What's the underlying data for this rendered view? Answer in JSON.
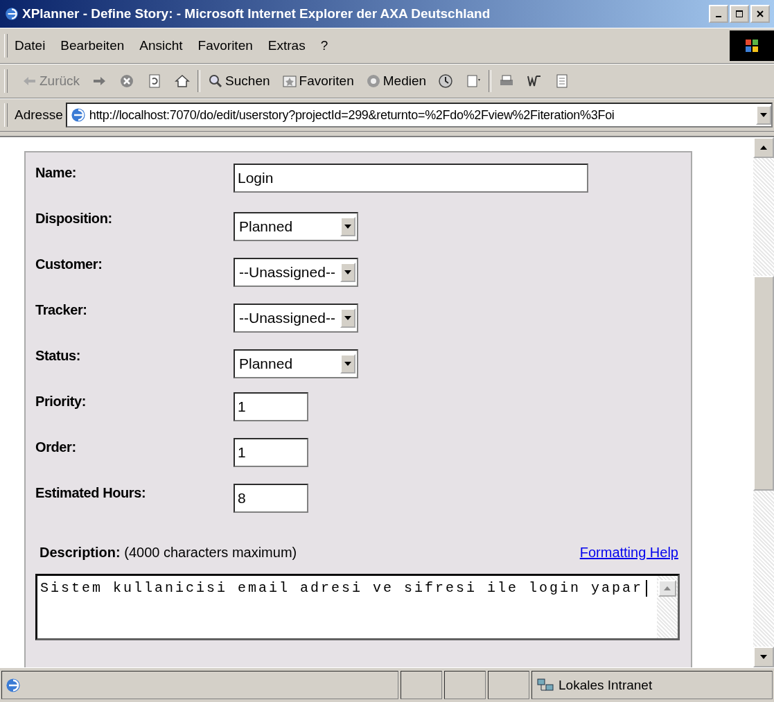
{
  "window": {
    "title": "XPlanner - Define Story: - Microsoft Internet Explorer der AXA Deutschland"
  },
  "menu": [
    "Datei",
    "Bearbeiten",
    "Ansicht",
    "Favoriten",
    "Extras",
    "?"
  ],
  "toolbar": [
    {
      "kind": "back",
      "label": "Zurück",
      "disabled": true
    },
    {
      "kind": "forward",
      "disabled": false
    },
    {
      "kind": "stop"
    },
    {
      "kind": "refresh"
    },
    {
      "kind": "home"
    },
    {
      "kind": "search",
      "label": "Suchen"
    },
    {
      "kind": "favorites",
      "label": "Favoriten"
    },
    {
      "kind": "media",
      "label": "Medien"
    },
    {
      "kind": "history"
    },
    {
      "kind": "mail"
    },
    {
      "kind": "print"
    },
    {
      "kind": "edit"
    },
    {
      "kind": "discuss"
    }
  ],
  "address": {
    "label": "Adresse",
    "value": "http://localhost:7070/do/edit/userstory?projectId=299&returnto=%2Fdo%2Fview%2Fiteration%3Foi"
  },
  "form": {
    "fields": [
      {
        "label": "Name:",
        "kind": "text",
        "value": "Login"
      },
      {
        "label": "Disposition:",
        "kind": "select",
        "value": "Planned"
      },
      {
        "label": "Customer:",
        "kind": "select",
        "value": "--Unassigned--"
      },
      {
        "label": "Tracker:",
        "kind": "select",
        "value": "--Unassigned--"
      },
      {
        "label": "Status:",
        "kind": "select",
        "value": "Planned"
      },
      {
        "label": "Priority:",
        "kind": "number",
        "value": "1"
      },
      {
        "label": "Order:",
        "kind": "number",
        "value": "1"
      },
      {
        "label": "Estimated Hours:",
        "kind": "number",
        "value": "8"
      }
    ],
    "description": {
      "label": "Description:",
      "hint": "(4000 characters maximum)",
      "link": "Formatting Help",
      "value": "Sistem kullanicisi email adresi ve sifresi ile login yapar"
    }
  },
  "status_bar": {
    "zone": "Lokales Intranet"
  }
}
